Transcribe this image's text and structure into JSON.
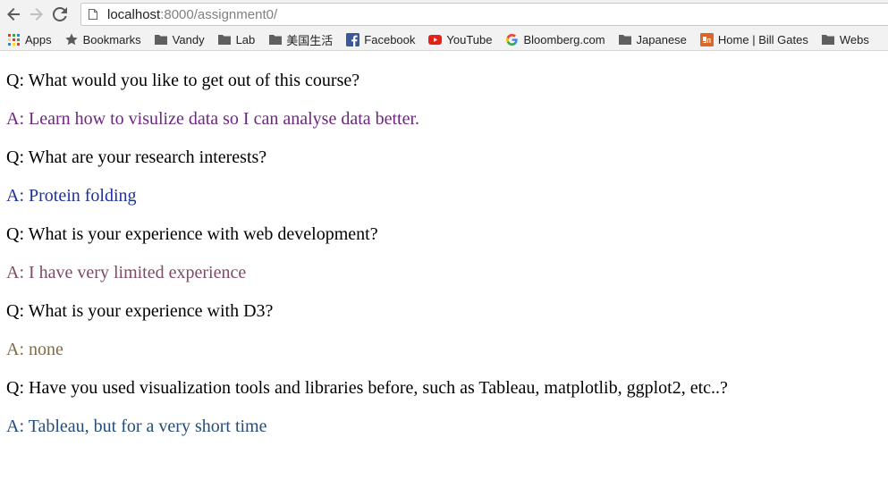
{
  "browser": {
    "url_host": "localhost",
    "url_path": ":8000/assignment0/"
  },
  "bookmarks": [
    {
      "label": "Apps",
      "icon": "apps-grid-icon"
    },
    {
      "label": "Bookmarks",
      "icon": "star-icon"
    },
    {
      "label": "Vandy",
      "icon": "folder-icon"
    },
    {
      "label": "Lab",
      "icon": "folder-icon"
    },
    {
      "label": "美国生活",
      "icon": "folder-icon"
    },
    {
      "label": "Facebook",
      "icon": "facebook-icon"
    },
    {
      "label": "YouTube",
      "icon": "youtube-icon"
    },
    {
      "label": "Bloomberg.com",
      "icon": "google-icon"
    },
    {
      "label": "Japanese",
      "icon": "folder-icon"
    },
    {
      "label": "Home | Bill Gates",
      "icon": "gn-icon"
    },
    {
      "label": "Webs",
      "icon": "folder-icon"
    }
  ],
  "qa": [
    {
      "text": "Q: What would you like to get out of this course?",
      "color": "#000000"
    },
    {
      "text": "A: Learn how to visulize data so I can analyse data better.",
      "color": "#6e2683"
    },
    {
      "text": "Q: What are your research interests?",
      "color": "#000000"
    },
    {
      "text": "A: Protein folding",
      "color": "#1f2f9b"
    },
    {
      "text": "Q: What is your experience with web development?",
      "color": "#000000"
    },
    {
      "text": "A: I have very limited experience",
      "color": "#7e4a66"
    },
    {
      "text": "Q: What is your experience with D3?",
      "color": "#000000"
    },
    {
      "text": "A: none",
      "color": "#7f6b4a"
    },
    {
      "text": "Q: Have you used visualization tools and libraries before, such as Tableau, matplotlib, ggplot2, etc..?",
      "color": "#000000"
    },
    {
      "text": "A: Tableau, but for a very short time",
      "color": "#254d7b"
    }
  ]
}
